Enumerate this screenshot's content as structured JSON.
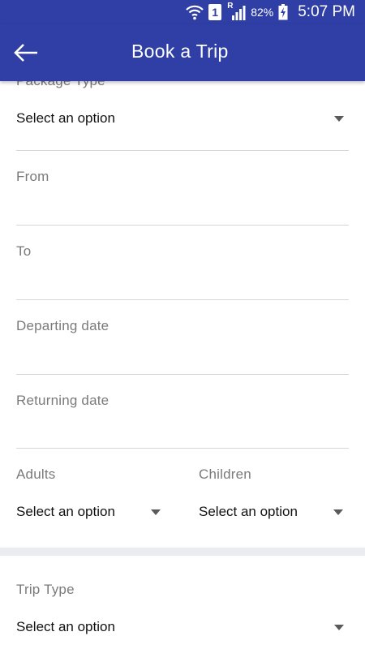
{
  "status_bar": {
    "battery_percent": "82%",
    "time": "5:07 PM",
    "sim_slot": "1",
    "roaming_indicator": "R",
    "icons": [
      "wifi-icon",
      "sim-1-icon",
      "signal-icon",
      "battery-charging-icon"
    ]
  },
  "app_bar": {
    "title": "Book a Trip",
    "back_icon": "arrow-left-icon",
    "color": "#2f3fa6"
  },
  "form": {
    "package_type": {
      "label": "Package Type",
      "value": "Select an option"
    },
    "from": {
      "label": "From",
      "value": ""
    },
    "to": {
      "label": "To",
      "value": ""
    },
    "departing_date": {
      "label": "Departing date",
      "value": ""
    },
    "returning_date": {
      "label": "Returning date",
      "value": ""
    },
    "adults": {
      "label": "Adults",
      "value": "Select an option"
    },
    "children": {
      "label": "Children",
      "value": "Select an option"
    },
    "trip_type": {
      "label": "Trip Type",
      "value": "Select an option"
    }
  }
}
